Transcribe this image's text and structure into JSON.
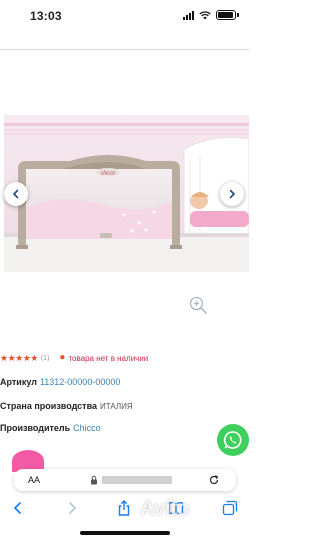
{
  "status_bar": {
    "time": "13:03",
    "signal_icon": "signal-icon",
    "wifi_icon": "wifi-icon",
    "battery_icon": "battery-icon"
  },
  "gallery": {
    "image_alt": "Chicco bed rail product photo",
    "brand_on_product": "chicco",
    "prev_icon": "chevron-left-icon",
    "next_icon": "chevron-right-icon",
    "zoom_icon": "zoom-in-icon"
  },
  "rating": {
    "stars": "★★★★★",
    "count": "(1)",
    "stock_status": "товара нет в наличии",
    "star_color": "#e5522b",
    "stock_color": "#d0284a"
  },
  "product_info": {
    "article_label": "Артикул",
    "article_value": "11312-00000-00000",
    "country_label": "Страна производства",
    "country_value": "ИТАЛИЯ",
    "maker_label": "Производитель",
    "maker_value": "Chicco",
    "link_color": "#3f7fb0"
  },
  "floating": {
    "whatsapp_icon": "whatsapp-icon",
    "whatsapp_color": "#3fcf5f",
    "pink_bubble_color": "#f25aa6"
  },
  "browser": {
    "text_size_label": "AA",
    "lock_icon": "lock-icon",
    "reload_icon": "reload-icon",
    "toolbar": [
      "back-icon",
      "forward-icon",
      "share-icon",
      "bookmarks-icon",
      "tabs-icon"
    ]
  },
  "watermark": {
    "text": "Avito"
  }
}
